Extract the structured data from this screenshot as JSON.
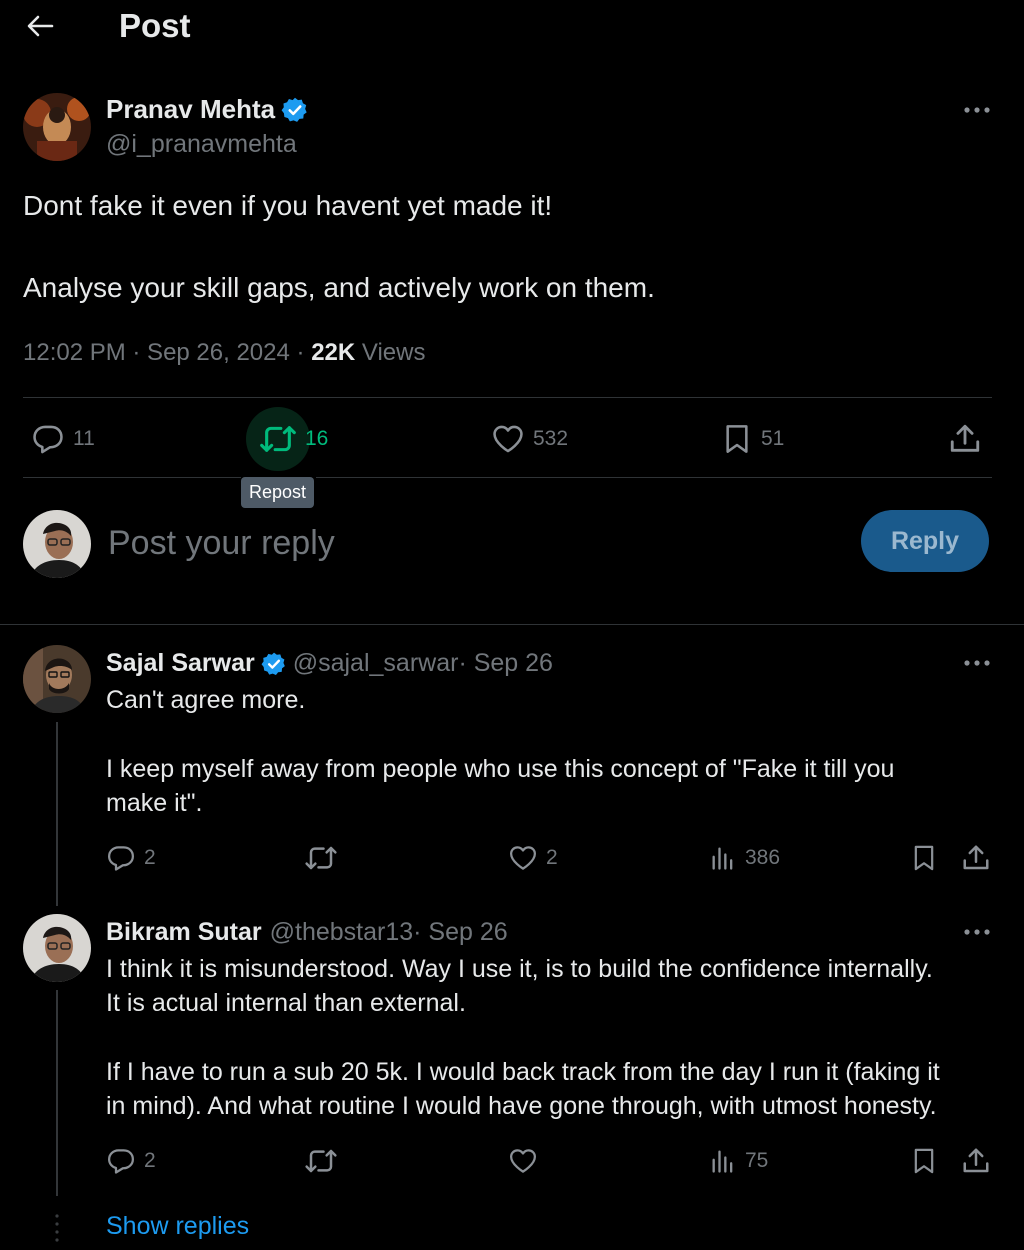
{
  "header": {
    "title": "Post"
  },
  "post": {
    "author_name": "Pranav Mehta",
    "author_handle": "@i_pranavmehta",
    "text_line1": "Dont fake it even if you havent yet made it!",
    "text_line2": "Analyse your skill gaps, and actively work on them.",
    "time": "12:02 PM · Sep 26, 2024 · ",
    "views_count": "22K",
    "views_label": " Views",
    "stats": {
      "replies": "11",
      "reposts": "16",
      "likes": "532",
      "bookmarks": "51"
    },
    "tooltip": "Repost"
  },
  "composer": {
    "placeholder": "Post your reply",
    "button_label": "Reply"
  },
  "replies": [
    {
      "author_name": "Sajal Sarwar",
      "author_handle": "@sajal_sarwar",
      "date": " · Sep 26",
      "para1": "Can't agree more.",
      "para2_line1": "I keep myself away from people who use this concept of \"Fake it till you",
      "para2_line2": "make it\".",
      "stats": {
        "replies": "2",
        "likes": "2",
        "views": "386"
      }
    },
    {
      "author_name": "Bikram Sutar",
      "author_handle": "@thebstar13",
      "date": " · Sep 26",
      "para1_line1": "I think it is misunderstood. Way I use it, is to build the confidence internally.",
      "para1_line2": "It is actual internal than external.",
      "para2_line1": "If I have to run a sub 20 5k. I would back track from the day I run it (faking it",
      "para2_line2": "in mind). And what routine I would have gone through, with utmost honesty.",
      "stats": {
        "replies": "2",
        "views": "75"
      }
    }
  ],
  "show_replies": "Show replies",
  "colors": {
    "accent": "#1d9bf0",
    "repost": "#00ba7c",
    "muted": "#71767b",
    "reply_button": "#1a5a8c"
  }
}
